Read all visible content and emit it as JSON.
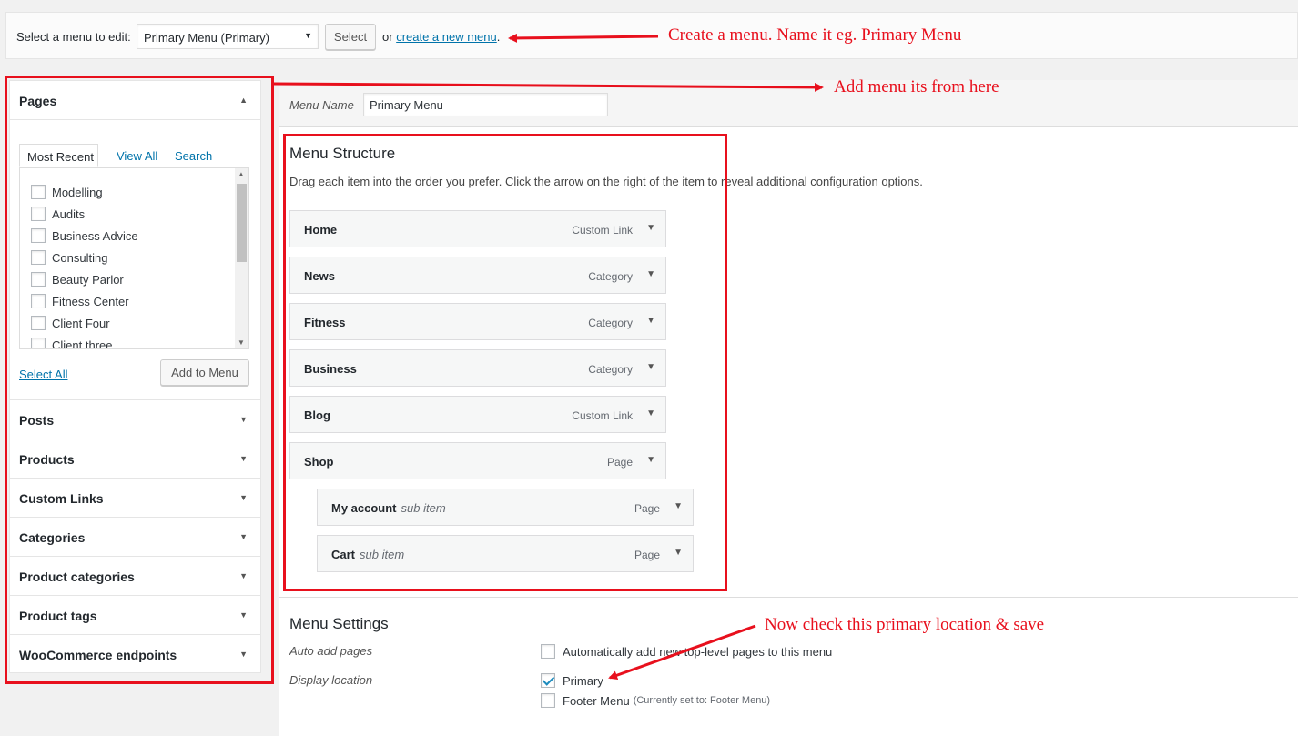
{
  "top_bar": {
    "label": "Select a menu to edit:",
    "selected_menu": "Primary Menu (Primary)",
    "select_button": "Select",
    "or_text": "or",
    "create_link": "create a new menu",
    "trailing": "."
  },
  "sidebar": {
    "pages": {
      "title": "Pages",
      "tabs": [
        "Most Recent",
        "View All",
        "Search"
      ],
      "items": [
        "Modelling",
        "Audits",
        "Business Advice",
        "Consulting",
        "Beauty Parlor",
        "Fitness Center",
        "Client Four",
        "Client three"
      ],
      "select_all": "Select All",
      "add_button": "Add to Menu"
    },
    "sections": [
      "Posts",
      "Products",
      "Custom Links",
      "Categories",
      "Product categories",
      "Product tags",
      "WooCommerce endpoints"
    ]
  },
  "menu_name": {
    "label": "Menu Name",
    "value": "Primary Menu"
  },
  "structure": {
    "title": "Menu Structure",
    "description": "Drag each item into the order you prefer. Click the arrow on the right of the item to reveal additional configuration options.",
    "items": [
      {
        "title": "Home",
        "sub": "",
        "type": "Custom Link"
      },
      {
        "title": "News",
        "sub": "",
        "type": "Category"
      },
      {
        "title": "Fitness",
        "sub": "",
        "type": "Category"
      },
      {
        "title": "Business",
        "sub": "",
        "type": "Category"
      },
      {
        "title": "Blog",
        "sub": "",
        "type": "Custom Link"
      },
      {
        "title": "Shop",
        "sub": "",
        "type": "Page"
      },
      {
        "title": "My account",
        "sub": "sub item",
        "type": "Page"
      },
      {
        "title": "Cart",
        "sub": "sub item",
        "type": "Page"
      }
    ]
  },
  "settings": {
    "title": "Menu Settings",
    "auto_add_label": "Auto add pages",
    "auto_add_option": "Automatically add new top-level pages to this menu",
    "auto_add_checked": false,
    "display_label": "Display location",
    "locations": [
      {
        "name": "Primary",
        "note": "",
        "checked": true
      },
      {
        "name": "Footer Menu",
        "note": "(Currently set to: Footer Menu)",
        "checked": false
      }
    ]
  },
  "annotations": {
    "create_menu": "Create a menu. Name it eg. Primary Menu",
    "add_items": "Add menu its from here",
    "check_location": "Now check this primary location & save",
    "color": "#e8101d"
  },
  "icons": {
    "collapse": "triangle-up-icon",
    "expand": "triangle-down-icon"
  }
}
